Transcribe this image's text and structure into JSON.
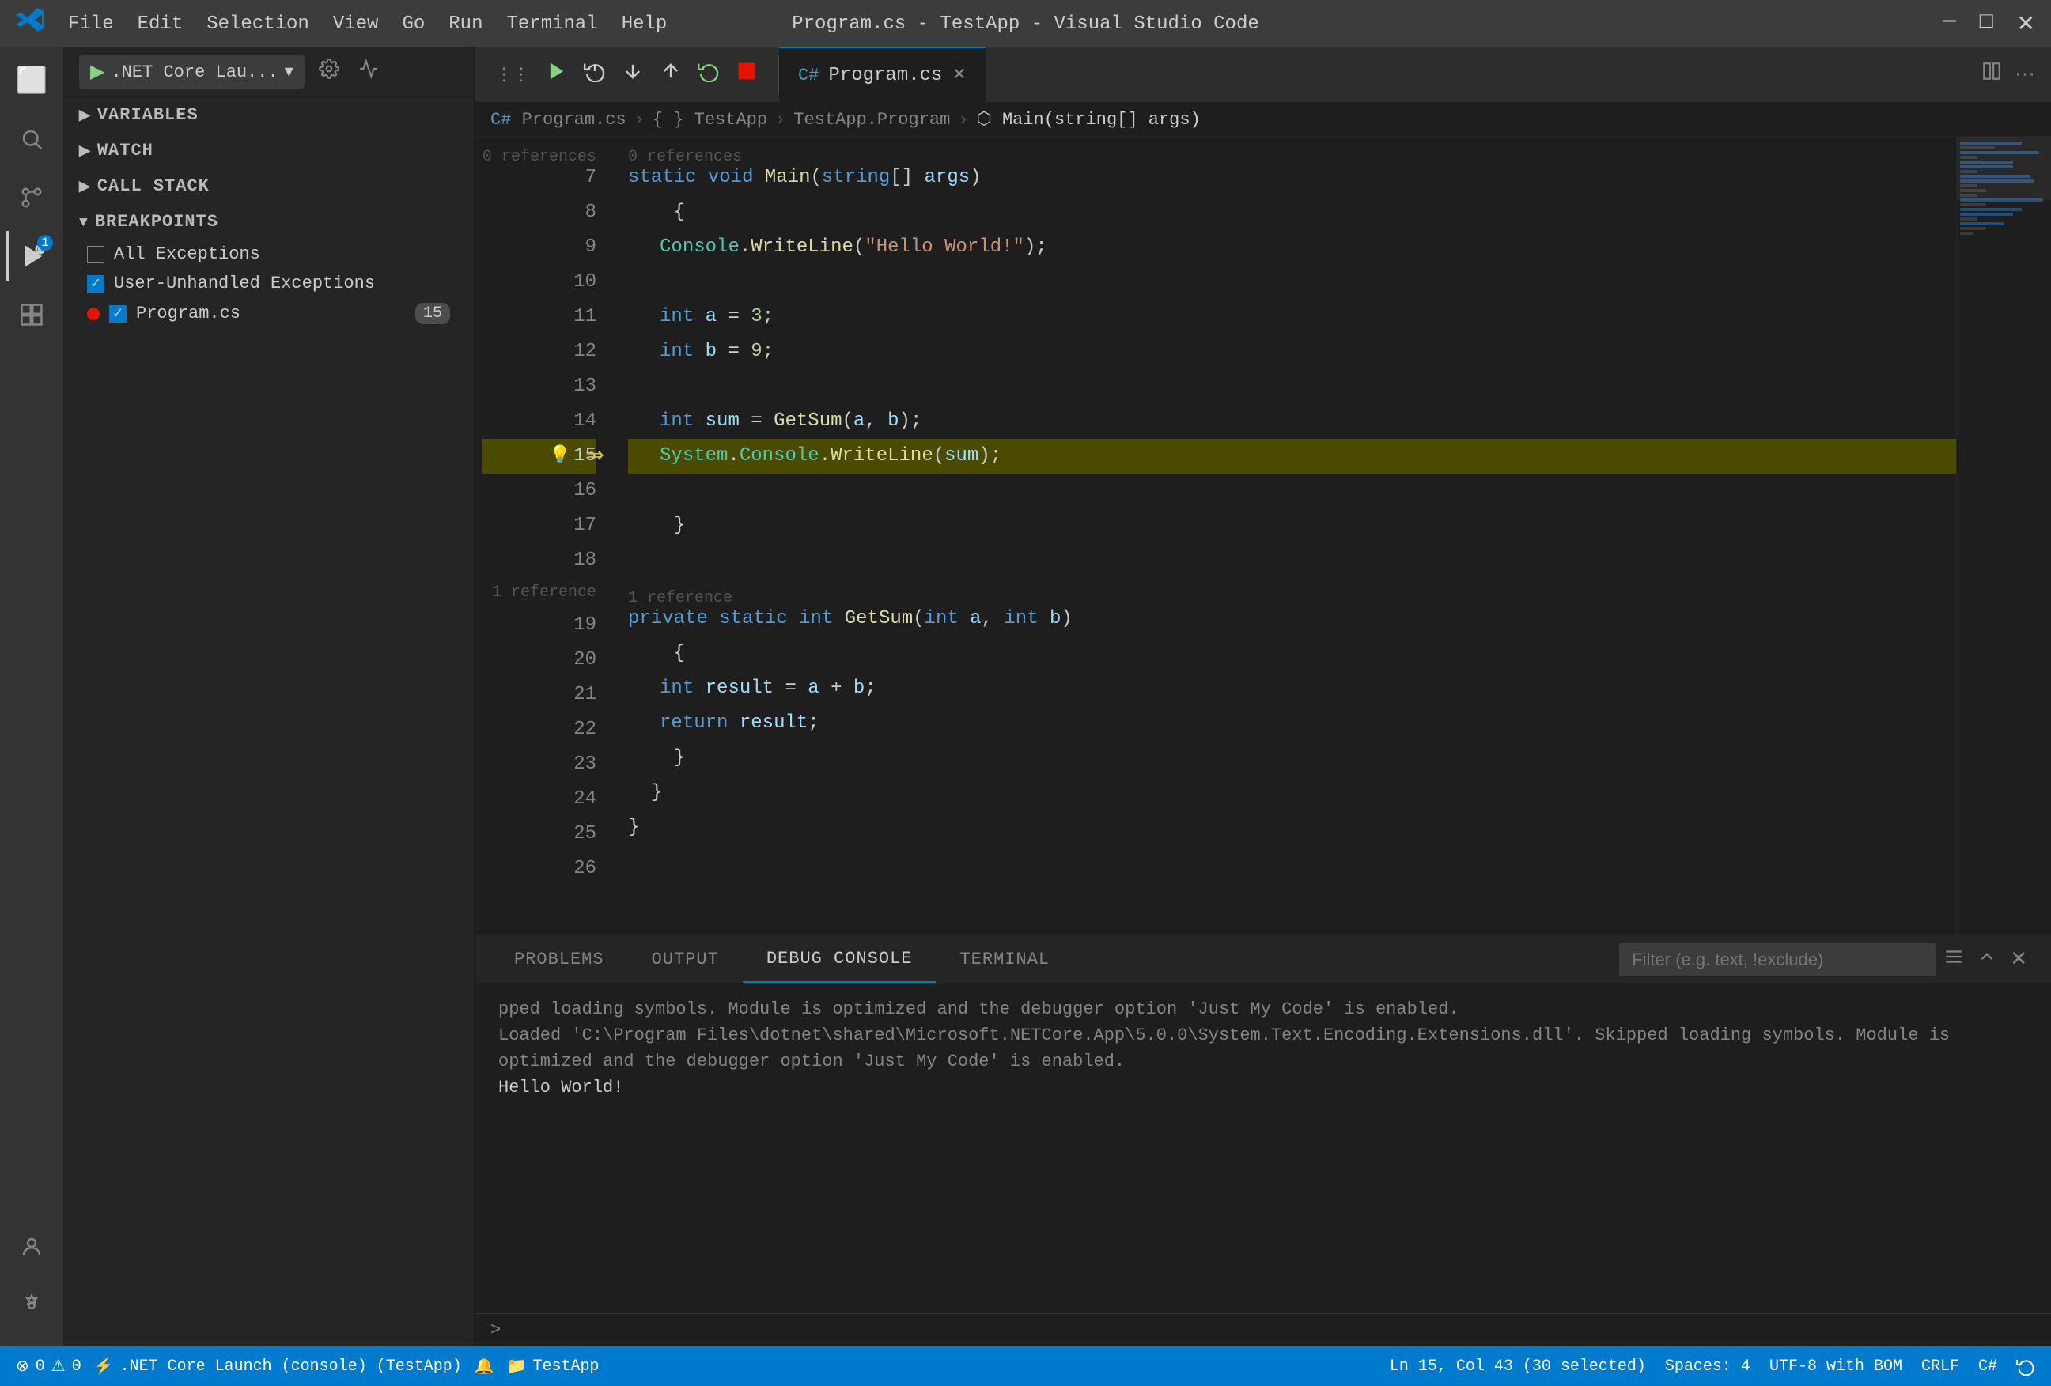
{
  "titlebar": {
    "title": "Program.cs - TestApp - Visual Studio Code",
    "menu": [
      "File",
      "Edit",
      "Selection",
      "View",
      "Go",
      "Run",
      "Terminal",
      "Help"
    ],
    "controls": [
      "─",
      "□",
      "✕"
    ]
  },
  "activity_bar": {
    "icons": [
      {
        "name": "explorer-icon",
        "symbol": "⬜",
        "active": false
      },
      {
        "name": "search-icon",
        "symbol": "🔍",
        "active": false
      },
      {
        "name": "source-control-icon",
        "symbol": "⑂",
        "active": false
      },
      {
        "name": "debug-icon",
        "symbol": "▶",
        "active": true,
        "badge": "1"
      },
      {
        "name": "extensions-icon",
        "symbol": "⊞",
        "active": false
      }
    ],
    "bottom_icons": [
      {
        "name": "account-icon",
        "symbol": "👤"
      },
      {
        "name": "settings-icon",
        "symbol": "⚙"
      }
    ]
  },
  "sidebar": {
    "debug_config": {
      "label": ".NET Core Lau...",
      "play_icon": "▶",
      "settings_icon": "⚙",
      "more_icon": "..."
    },
    "sections": [
      {
        "id": "variables",
        "label": "VARIABLES",
        "expanded": false,
        "chevron": "right"
      },
      {
        "id": "watch",
        "label": "WATCH",
        "expanded": false,
        "chevron": "right"
      },
      {
        "id": "call-stack",
        "label": "CALL STACK",
        "expanded": false,
        "chevron": "right"
      },
      {
        "id": "breakpoints",
        "label": "BREAKPOINTS",
        "expanded": true,
        "chevron": "down"
      }
    ],
    "breakpoints": {
      "items": [
        {
          "label": "All Exceptions",
          "checked": false
        },
        {
          "label": "User-Unhandled Exceptions",
          "checked": true
        },
        {
          "label": "Program.cs",
          "checked": true,
          "has_dot": true,
          "count": "15"
        }
      ]
    }
  },
  "editor": {
    "tab": {
      "filename": "Program.cs",
      "icon": "C#",
      "modified": false
    },
    "breadcrumb": [
      {
        "label": "Program.cs",
        "icon": "C#"
      },
      {
        "label": "{ } TestApp"
      },
      {
        "label": "TestApp.Program"
      },
      {
        "label": "⬡ Main(string[] args)",
        "active": true
      }
    ],
    "debug_toolbar": {
      "icons": [
        {
          "name": "dots-icon",
          "symbol": "⋮⋮"
        },
        {
          "name": "continue-icon",
          "symbol": "▶"
        },
        {
          "name": "step-over-icon",
          "symbol": "↺"
        },
        {
          "name": "step-into-icon",
          "symbol": "↓"
        },
        {
          "name": "step-out-icon",
          "symbol": "↑"
        },
        {
          "name": "restart-icon",
          "symbol": "↺"
        },
        {
          "name": "stop-icon",
          "symbol": "⬛"
        }
      ]
    },
    "code": {
      "references_top": "0 references",
      "lines": [
        {
          "num": 7,
          "content": "    static void Main(string[] args)",
          "tokens": [
            {
              "text": "    ",
              "class": ""
            },
            {
              "text": "static",
              "class": "kw"
            },
            {
              "text": " ",
              "class": ""
            },
            {
              "text": "void",
              "class": "kw"
            },
            {
              "text": " ",
              "class": ""
            },
            {
              "text": "Main",
              "class": "fn"
            },
            {
              "text": "(",
              "class": ""
            },
            {
              "text": "string",
              "class": "kw"
            },
            {
              "text": "[] ",
              "class": ""
            },
            {
              "text": "args",
              "class": "ref"
            },
            {
              "text": ")",
              "class": ""
            }
          ]
        },
        {
          "num": 8,
          "content": "    {",
          "tokens": [
            {
              "text": "    {",
              "class": ""
            }
          ]
        },
        {
          "num": 9,
          "content": "        Console.WriteLine(\"Hello World!\");",
          "tokens": [
            {
              "text": "        ",
              "class": ""
            },
            {
              "text": "Console",
              "class": "type"
            },
            {
              "text": ".",
              "class": ""
            },
            {
              "text": "WriteLine",
              "class": "fn"
            },
            {
              "text": "(",
              "class": ""
            },
            {
              "text": "\"Hello World!\"",
              "class": "str"
            },
            {
              "text": ");",
              "class": ""
            }
          ]
        },
        {
          "num": 10,
          "content": "",
          "tokens": []
        },
        {
          "num": 11,
          "content": "        int a = 3;",
          "tokens": [
            {
              "text": "        ",
              "class": ""
            },
            {
              "text": "int",
              "class": "kw"
            },
            {
              "text": " ",
              "class": ""
            },
            {
              "text": "a",
              "class": "ref"
            },
            {
              "text": " = ",
              "class": ""
            },
            {
              "text": "3",
              "class": "num"
            },
            {
              "text": ";",
              "class": ""
            }
          ]
        },
        {
          "num": 12,
          "content": "        int b = 9;",
          "tokens": [
            {
              "text": "        ",
              "class": ""
            },
            {
              "text": "int",
              "class": "kw"
            },
            {
              "text": " ",
              "class": ""
            },
            {
              "text": "b",
              "class": "ref"
            },
            {
              "text": " = ",
              "class": ""
            },
            {
              "text": "9",
              "class": "num"
            },
            {
              "text": ";",
              "class": ""
            }
          ]
        },
        {
          "num": 13,
          "content": "",
          "tokens": []
        },
        {
          "num": 14,
          "content": "        int sum = GetSum(a, b);",
          "tokens": [
            {
              "text": "        ",
              "class": ""
            },
            {
              "text": "int",
              "class": "kw"
            },
            {
              "text": " ",
              "class": ""
            },
            {
              "text": "sum",
              "class": "ref"
            },
            {
              "text": " = ",
              "class": ""
            },
            {
              "text": "GetSum",
              "class": "fn"
            },
            {
              "text": "(",
              "class": ""
            },
            {
              "text": "a",
              "class": "ref"
            },
            {
              "text": ", ",
              "class": ""
            },
            {
              "text": "b",
              "class": "ref"
            },
            {
              "text": ");",
              "class": ""
            }
          ]
        },
        {
          "num": 15,
          "content": "        System.Console.WriteLine(sum);",
          "tokens": [
            {
              "text": "        ",
              "class": ""
            },
            {
              "text": "System",
              "class": "type"
            },
            {
              "text": ".",
              "class": ""
            },
            {
              "text": "Console",
              "class": "type"
            },
            {
              "text": ".",
              "class": ""
            },
            {
              "text": "WriteLine",
              "class": "fn"
            },
            {
              "text": "(",
              "class": ""
            },
            {
              "text": "sum",
              "class": "ref"
            },
            {
              "text": ");",
              "class": ""
            }
          ],
          "highlighted": true,
          "has_bp": true,
          "has_arrow": true,
          "has_lightbulb": true
        },
        {
          "num": 16,
          "content": "",
          "tokens": []
        },
        {
          "num": 17,
          "content": "    }",
          "tokens": [
            {
              "text": "    }",
              "class": ""
            }
          ]
        },
        {
          "num": 18,
          "content": "",
          "tokens": []
        },
        {
          "num": 19,
          "content": "",
          "tokens": [],
          "is_ref": true,
          "ref_text": "1 reference"
        },
        {
          "num": 19,
          "content": "    private static int GetSum(int a, int b)",
          "tokens": [
            {
              "text": "    ",
              "class": ""
            },
            {
              "text": "private",
              "class": "kw"
            },
            {
              "text": " ",
              "class": ""
            },
            {
              "text": "static",
              "class": "kw"
            },
            {
              "text": " ",
              "class": ""
            },
            {
              "text": "int",
              "class": "kw"
            },
            {
              "text": " ",
              "class": ""
            },
            {
              "text": "GetSum",
              "class": "fn"
            },
            {
              "text": "(",
              "class": ""
            },
            {
              "text": "int",
              "class": "kw"
            },
            {
              "text": " ",
              "class": ""
            },
            {
              "text": "a",
              "class": "ref"
            },
            {
              "text": ", ",
              "class": ""
            },
            {
              "text": "int",
              "class": "kw"
            },
            {
              "text": " ",
              "class": ""
            },
            {
              "text": "b",
              "class": "ref"
            },
            {
              "text": ")",
              "class": ""
            }
          ]
        },
        {
          "num": 20,
          "content": "    {",
          "tokens": [
            {
              "text": "    {",
              "class": ""
            }
          ]
        },
        {
          "num": 21,
          "content": "        int result = a + b;",
          "tokens": [
            {
              "text": "        ",
              "class": ""
            },
            {
              "text": "int",
              "class": "kw"
            },
            {
              "text": " ",
              "class": ""
            },
            {
              "text": "result",
              "class": "ref"
            },
            {
              "text": " = ",
              "class": ""
            },
            {
              "text": "a",
              "class": "ref"
            },
            {
              "text": " + ",
              "class": ""
            },
            {
              "text": "b",
              "class": "ref"
            },
            {
              "text": ";",
              "class": ""
            }
          ]
        },
        {
          "num": 22,
          "content": "        return result;",
          "tokens": [
            {
              "text": "        ",
              "class": ""
            },
            {
              "text": "return",
              "class": "kw"
            },
            {
              "text": " ",
              "class": ""
            },
            {
              "text": "result",
              "class": "ref"
            },
            {
              "text": ";",
              "class": ""
            }
          ]
        },
        {
          "num": 23,
          "content": "    }",
          "tokens": [
            {
              "text": "    }",
              "class": ""
            }
          ]
        },
        {
          "num": 24,
          "content": "  }",
          "tokens": [
            {
              "text": "  }",
              "class": ""
            }
          ]
        },
        {
          "num": 25,
          "content": "}",
          "tokens": [
            {
              "text": "}",
              "class": ""
            }
          ]
        },
        {
          "num": 26,
          "content": "",
          "tokens": []
        }
      ]
    }
  },
  "bottom_panel": {
    "tabs": [
      {
        "label": "PROBLEMS",
        "active": false
      },
      {
        "label": "OUTPUT",
        "active": false
      },
      {
        "label": "DEBUG CONSOLE",
        "active": true
      },
      {
        "label": "TERMINAL",
        "active": false
      }
    ],
    "filter_placeholder": "Filter (e.g. text, !exclude)",
    "console_output": [
      "pped loading symbols. Module is optimized and the debugger option 'Just My Code' is enabled.",
      "Loaded 'C:\\Program Files\\dotnet\\shared\\Microsoft.NETCore.App\\5.0.0\\System.Text.Encoding.Extensions.dll'. Skipped loading symbols. Module is optimized and the debugger option 'Just My Code' is enabled.",
      "Hello World!"
    ],
    "prompt_arrow": ">"
  },
  "status_bar": {
    "left": [
      {
        "name": "errors",
        "text": "⊗ 0",
        "icon": "error-icon"
      },
      {
        "name": "warnings",
        "text": "⚠ 0",
        "icon": "warning-icon"
      },
      {
        "name": "run-config",
        "text": ".NET Core Launch (console) (TestApp)"
      }
    ],
    "right": [
      {
        "name": "line-col",
        "text": "Ln 15, Col 43 (30 selected)"
      },
      {
        "name": "spaces",
        "text": "Spaces: 4"
      },
      {
        "name": "encoding",
        "text": "UTF-8 with BOM"
      },
      {
        "name": "line-ending",
        "text": "CRLF"
      },
      {
        "name": "language",
        "text": "C#"
      },
      {
        "name": "notifications",
        "text": "🔔"
      },
      {
        "name": "live-share",
        "text": "TestApp",
        "icon": "folder-icon"
      },
      {
        "name": "sync",
        "text": "⚡",
        "icon": "sync-icon"
      }
    ]
  }
}
